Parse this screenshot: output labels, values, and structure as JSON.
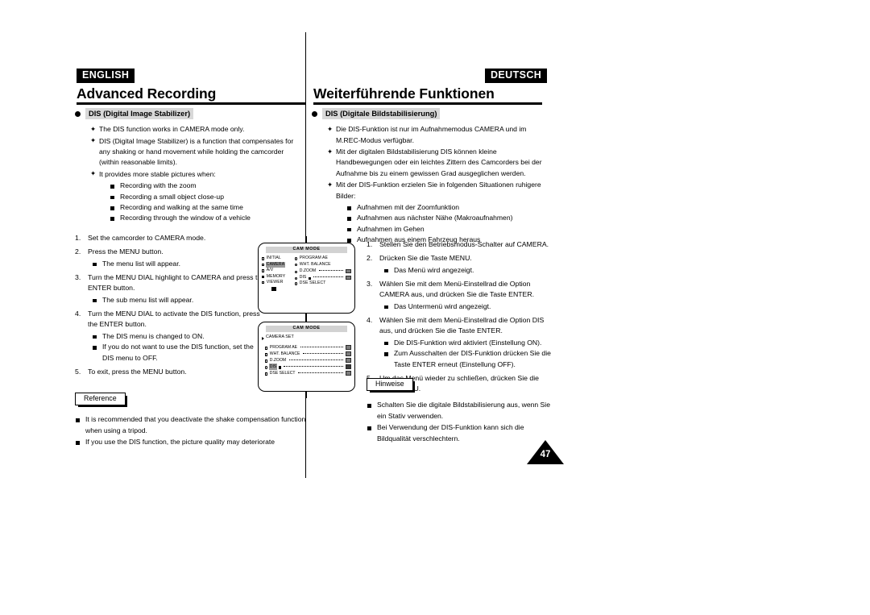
{
  "page": {
    "number": "47",
    "lang_left": "ENGLISH",
    "lang_right": "DEUTSCH"
  },
  "left": {
    "chapter_title": "Advanced Recording",
    "section_title": "DIS (Digital Image Stabilizer)",
    "intro": [
      "The DIS function works in CAMERA mode only.",
      "DIS (Digital Image Stabilizer) is a function that compensates for any shaking or hand movement while holding the camcorder (within reasonable limits).",
      "It provides more stable pictures when:"
    ],
    "intro_sub": [
      "Recording with the zoom",
      "Recording a small object close-up",
      "Recording and walking at the same time",
      "Recording through the window of a vehicle"
    ],
    "steps": [
      {
        "num": "1.",
        "text": "Set the camcorder to CAMERA mode.",
        "sub": []
      },
      {
        "num": "2.",
        "text": "Press the MENU button.",
        "sub": [
          "The menu list will appear."
        ]
      },
      {
        "num": "3.",
        "text": "Turn the MENU DIAL highlight to CAMERA and press the ENTER button.",
        "sub": [
          "The sub menu list will appear."
        ]
      },
      {
        "num": "4.",
        "text": "Turn the MENU DIAL to activate the DIS function, press the ENTER button.",
        "sub": [
          "The DIS menu is changed to ON.",
          "If you do not want to use the DIS function, set the DIS menu to OFF."
        ]
      },
      {
        "num": "5.",
        "text": "To exit, press the MENU button.",
        "sub": []
      }
    ],
    "note_label": "Reference",
    "notes": [
      "It is recommended that you deactivate the shake compensation function when using a tripod.",
      "If you use the DIS function, the picture quality may deteriorate"
    ]
  },
  "right": {
    "chapter_title": "Weiterführende Funktionen",
    "section_title": "DIS (Digitale Bildstabilisierung)",
    "intro": [
      "Die DIS-Funktion ist nur im Aufnahmemodus CAMERA und im M.REC-Modus verfügbar.",
      "Mit der digitalen Bildstabilisierung DIS können kleine Handbewegungen oder ein leichtes Zittern des Camcorders bei der Aufnahme bis zu einem gewissen Grad ausgeglichen werden.",
      "Mit der DIS-Funktion erzielen Sie in folgenden Situationen ruhigere Bilder:"
    ],
    "intro_sub": [
      "Aufnahmen mit der Zoomfunktion",
      "Aufnahmen aus nächster Nähe (Makroaufnahmen)",
      "Aufnahmen im Gehen",
      "Aufnahmen aus einem Fahrzeug heraus"
    ],
    "steps": [
      {
        "num": "1.",
        "text": "Stellen Sie den Betriebsmodus-Schalter auf CAMERA.",
        "sub": []
      },
      {
        "num": "2.",
        "text": "Drücken Sie die Taste MENU.",
        "sub": [
          "Das Menü wird angezeigt."
        ]
      },
      {
        "num": "3.",
        "text": "Wählen Sie mit dem Menü-Einstellrad die Option CAMERA aus, und drücken Sie die Taste ENTER.",
        "sub": [
          "Das Untermenü wird angezeigt."
        ]
      },
      {
        "num": "4.",
        "text": "Wählen Sie mit dem Menü-Einstellrad die Option DIS aus, und drücken Sie die Taste ENTER.",
        "sub": [
          "Die DIS-Funktion wird aktiviert (Einstellung ON).",
          "Zum Ausschalten der DIS-Funktion drücken Sie die Taste ENTER erneut (Einstellung OFF)."
        ]
      },
      {
        "num": "5.",
        "text": "Um das Menü wieder zu schließen, drücken Sie die Taste MENU.",
        "sub": []
      }
    ],
    "note_label": "Hinweise",
    "notes": [
      "Schalten Sie die digitale Bildstabilisierung aus, wenn Sie ein Stativ verwenden.",
      "Bei Verwendung der DIS-Funktion kann sich die Bildqualität verschlechtern."
    ]
  },
  "lcd_main": {
    "titlebar": "CAM MODE",
    "left_items": [
      {
        "label": "INITIAL",
        "glyph": "sq-open",
        "highlight": false
      },
      {
        "label": "CAMERA",
        "glyph": "sq-open",
        "highlight": true
      },
      {
        "label": "A/V",
        "glyph": "sq-open",
        "highlight": false
      },
      {
        "label": "MEMORY",
        "glyph": "sq-fill",
        "highlight": false
      },
      {
        "label": "VIEWER",
        "glyph": "sq-open",
        "highlight": false
      }
    ],
    "right_items": [
      {
        "label": "PROGRAM AE",
        "trail": false
      },
      {
        "label": "WHT. BALANCE",
        "trail": false
      },
      {
        "label": "D.ZOOM",
        "trail": true
      },
      {
        "label": "DIS",
        "trail": true
      },
      {
        "label": "DSE SELECT",
        "trail": false
      }
    ]
  },
  "lcd_sub": {
    "titlebar": "CAM MODE",
    "header": "CAMERA SET",
    "rows": [
      {
        "label": "PROGRAM AE",
        "highlight": false
      },
      {
        "label": "WHT. BALANCE",
        "highlight": false
      },
      {
        "label": "D.ZOOM",
        "highlight": false
      },
      {
        "label": "DIS",
        "highlight": true
      },
      {
        "label": "DSE SELECT",
        "highlight": false
      }
    ]
  }
}
